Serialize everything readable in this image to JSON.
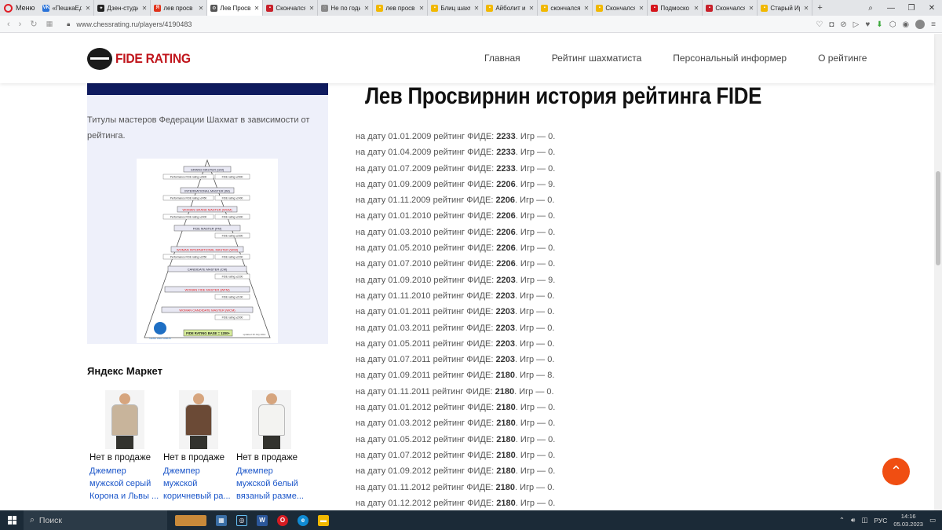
{
  "browser": {
    "menu_label": "Меню",
    "tabs": [
      {
        "title": "«ПешкаЕдь",
        "color": "#2a73d9",
        "glyph": "VK"
      },
      {
        "title": "Дзен-студи",
        "color": "#222222",
        "glyph": "✦"
      },
      {
        "title": "лев просв",
        "color": "#e0331b",
        "glyph": "Я"
      },
      {
        "title": "Лев Просв",
        "color": "#555555",
        "glyph": "⚙",
        "active": true
      },
      {
        "title": "Скончался",
        "color": "#c8202a",
        "glyph": "▪"
      },
      {
        "title": "Не по годи",
        "color": "#888888",
        "glyph": "◌"
      },
      {
        "title": "лев просв",
        "color": "#f1b800",
        "glyph": "▪"
      },
      {
        "title": "Блиц шахм",
        "color": "#f1b800",
        "glyph": "▪"
      },
      {
        "title": "Айболит и",
        "color": "#f1b800",
        "glyph": "▪"
      },
      {
        "title": "скончался",
        "color": "#f1b800",
        "glyph": "▪"
      },
      {
        "title": "Скончался",
        "color": "#f1b800",
        "glyph": "▪"
      },
      {
        "title": "Подмоско",
        "color": "#d5141b",
        "glyph": "▪"
      },
      {
        "title": "Скончался",
        "color": "#c8202a",
        "glyph": "▪"
      },
      {
        "title": "Старый Ир",
        "color": "#f1b800",
        "glyph": "▪"
      }
    ],
    "url": "www.chessrating.ru/players/4190483"
  },
  "site": {
    "logo_text": "FIDE RATING",
    "nav": [
      "Главная",
      "Рейтинг шахматиста",
      "Персональный информер",
      "О рейтинге"
    ]
  },
  "sidebar": {
    "titles_text": "Титулы мастеров Федерации Шахмат в зависимости от рейтинга.",
    "pyramid": {
      "levels": [
        {
          "name": "GRAND MASTER (GM)",
          "red": false,
          "perf": "Performance FIDE rating ≥2600",
          "fide": "FIDE rating ≥2500"
        },
        {
          "name": "INTERNATIONAL MASTER (IM)",
          "red": false,
          "perf": "Performance FIDE rating ≥2450",
          "fide": "FIDE rating ≥2400"
        },
        {
          "name": "WOMAN GRAND MASTER (WGM)",
          "red": true,
          "perf": "Performance FIDE rating ≥2400",
          "fide": "FIDE rating ≥2300"
        },
        {
          "name": "FIDE MASTER (FM)",
          "red": false,
          "perf": "",
          "fide": "FIDE rating ≥2300"
        },
        {
          "name": "WOMAN INTERNATIONAL MASTER (WIM)",
          "red": true,
          "perf": "Performance FIDE rating ≥2250",
          "fide": "FIDE rating ≥2200"
        },
        {
          "name": "CANDIDATE MASTER (CM)",
          "red": false,
          "perf": "",
          "fide": "FIDE rating ≥2200"
        },
        {
          "name": "WOMAN FIDE MASTER (WFM)",
          "red": true,
          "perf": "",
          "fide": "FIDE rating ≥2100"
        },
        {
          "name": "WOMAN CANDIDATE MASTER (WCM)",
          "red": true,
          "perf": "",
          "fide": "FIDE rating ≥2000"
        }
      ],
      "base": "FIDE RATING BASE = 1200+",
      "org": "GENS UNA SUMUS",
      "updated": "updated 15 July 2014"
    },
    "market_title": "Яндекс Маркет",
    "products": [
      {
        "status": "Нет в продаже",
        "name": "Джемпер мужской серый Корона и Львы ...",
        "color": "#c8b49b"
      },
      {
        "status": "Нет в продаже",
        "name": "Джемпер мужской коричневый ра...",
        "color": "#6b4a36"
      },
      {
        "status": "Нет в продаже",
        "name": "Джемпер мужской белый вязаный разме...",
        "color": "#f3f3f1"
      }
    ]
  },
  "main": {
    "title": "Лев Просвирнин история рейтинга FIDE",
    "row_prefix": "на дату",
    "row_mid": "рейтинг ФИДЕ:",
    "row_games": "Игр —",
    "ratings": [
      {
        "date": "01.01.2009",
        "rating": "2233",
        "games": "0"
      },
      {
        "date": "01.04.2009",
        "rating": "2233",
        "games": "0"
      },
      {
        "date": "01.07.2009",
        "rating": "2233",
        "games": "0"
      },
      {
        "date": "01.09.2009",
        "rating": "2206",
        "games": "9"
      },
      {
        "date": "01.11.2009",
        "rating": "2206",
        "games": "0"
      },
      {
        "date": "01.01.2010",
        "rating": "2206",
        "games": "0"
      },
      {
        "date": "01.03.2010",
        "rating": "2206",
        "games": "0"
      },
      {
        "date": "01.05.2010",
        "rating": "2206",
        "games": "0"
      },
      {
        "date": "01.07.2010",
        "rating": "2206",
        "games": "0"
      },
      {
        "date": "01.09.2010",
        "rating": "2203",
        "games": "9"
      },
      {
        "date": "01.11.2010",
        "rating": "2203",
        "games": "0"
      },
      {
        "date": "01.01.2011",
        "rating": "2203",
        "games": "0"
      },
      {
        "date": "01.03.2011",
        "rating": "2203",
        "games": "0"
      },
      {
        "date": "01.05.2011",
        "rating": "2203",
        "games": "0"
      },
      {
        "date": "01.07.2011",
        "rating": "2203",
        "games": "0"
      },
      {
        "date": "01.09.2011",
        "rating": "2180",
        "games": "8"
      },
      {
        "date": "01.11.2011",
        "rating": "2180",
        "games": "0"
      },
      {
        "date": "01.01.2012",
        "rating": "2180",
        "games": "0"
      },
      {
        "date": "01.03.2012",
        "rating": "2180",
        "games": "0"
      },
      {
        "date": "01.05.2012",
        "rating": "2180",
        "games": "0"
      },
      {
        "date": "01.07.2012",
        "rating": "2180",
        "games": "0"
      },
      {
        "date": "01.09.2012",
        "rating": "2180",
        "games": "0"
      },
      {
        "date": "01.11.2012",
        "rating": "2180",
        "games": "0"
      },
      {
        "date": "01.12.2012",
        "rating": "2180",
        "games": "0"
      }
    ]
  },
  "taskbar": {
    "search_placeholder": "Поиск",
    "lang": "РУС",
    "time": "14:16",
    "date": "05.03.2023"
  },
  "colors": {
    "accent": "#c0141b",
    "navy": "#0f1b5f",
    "scroll_top_button": "#f04e12",
    "link": "#1a55c9"
  }
}
